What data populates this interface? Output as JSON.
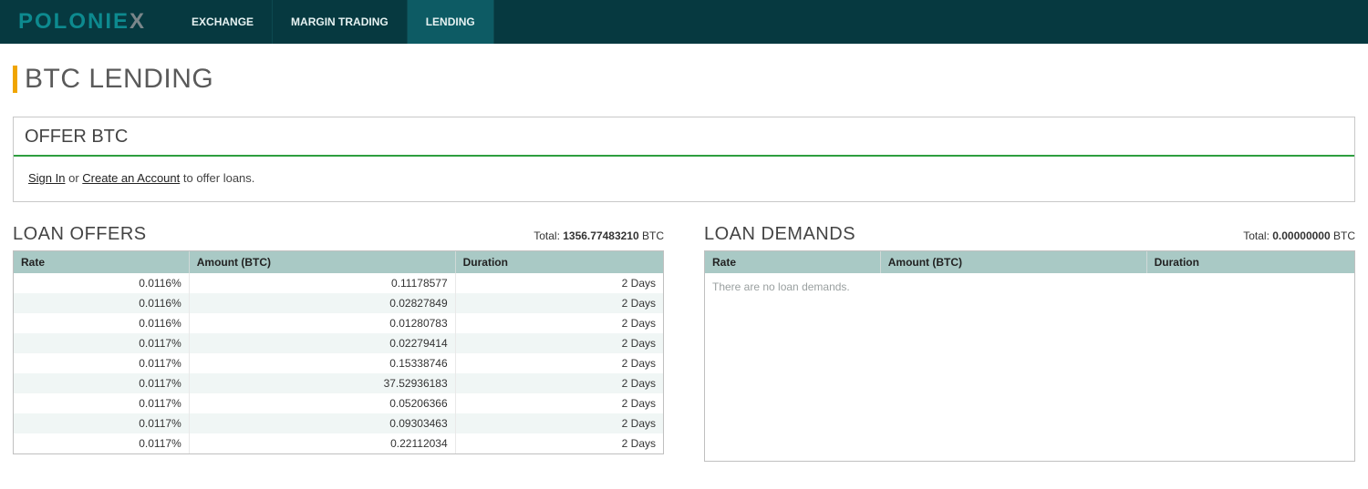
{
  "brand": {
    "part1": "POLONIE",
    "part2": "X"
  },
  "nav": {
    "items": [
      {
        "label": "EXCHANGE"
      },
      {
        "label": "MARGIN TRADING"
      },
      {
        "label": "LENDING"
      }
    ]
  },
  "page": {
    "title": "BTC LENDING"
  },
  "offer": {
    "header": "OFFER BTC",
    "sign_in": "Sign In",
    "or": " or ",
    "create": "Create an Account",
    "suffix": " to offer loans."
  },
  "loan_offers": {
    "title": "LOAN OFFERS",
    "total_label": "Total: ",
    "total_value": "1356.77483210",
    "total_unit": " BTC",
    "columns": {
      "rate": "Rate",
      "amount": "Amount (BTC)",
      "duration": "Duration"
    },
    "rows": [
      {
        "rate": "0.0116%",
        "amount": "0.11178577",
        "duration": "2 Days"
      },
      {
        "rate": "0.0116%",
        "amount": "0.02827849",
        "duration": "2 Days"
      },
      {
        "rate": "0.0116%",
        "amount": "0.01280783",
        "duration": "2 Days"
      },
      {
        "rate": "0.0117%",
        "amount": "0.02279414",
        "duration": "2 Days"
      },
      {
        "rate": "0.0117%",
        "amount": "0.15338746",
        "duration": "2 Days"
      },
      {
        "rate": "0.0117%",
        "amount": "37.52936183",
        "duration": "2 Days"
      },
      {
        "rate": "0.0117%",
        "amount": "0.05206366",
        "duration": "2 Days"
      },
      {
        "rate": "0.0117%",
        "amount": "0.09303463",
        "duration": "2 Days"
      },
      {
        "rate": "0.0117%",
        "amount": "0.22112034",
        "duration": "2 Days"
      }
    ]
  },
  "loan_demands": {
    "title": "LOAN DEMANDS",
    "total_label": "Total: ",
    "total_value": "0.00000000",
    "total_unit": " BTC",
    "columns": {
      "rate": "Rate",
      "amount": "Amount (BTC)",
      "duration": "Duration"
    },
    "empty": "There are no loan demands."
  }
}
